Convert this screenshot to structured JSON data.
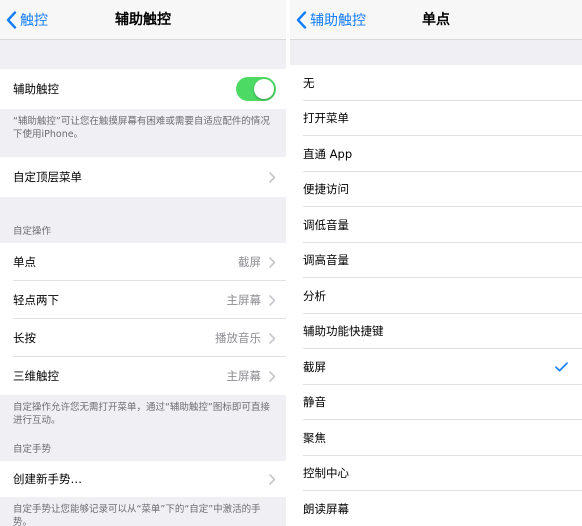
{
  "left": {
    "back_label": "触控",
    "title": "辅助触控",
    "toggle_row": {
      "label": "辅助触控",
      "on": true
    },
    "toggle_footer": "“辅助触控”可让您在触摸屏幕有困难或需要自适应配件的情况下使用iPhone。",
    "top_menu_label": "自定顶层菜单",
    "custom_actions_header": "自定操作",
    "actions": [
      {
        "label": "单点",
        "value": "截屏"
      },
      {
        "label": "轻点两下",
        "value": "主屏幕"
      },
      {
        "label": "长按",
        "value": "播放音乐"
      },
      {
        "label": "三维触控",
        "value": "主屏幕"
      }
    ],
    "actions_footer": "自定操作允许您无需打开菜单，通过“辅助触控”图标即可直接进行互动。",
    "gestures_header": "自定手势",
    "new_gesture_label": "创建新手势…",
    "gestures_footer": "自定手势让您能够记录可以从“菜单”下的“自定”中激活的手势。"
  },
  "right": {
    "back_label": "辅助触控",
    "title": "单点",
    "options": [
      {
        "label": "无"
      },
      {
        "label": "打开菜单"
      },
      {
        "label": "直通 App"
      },
      {
        "label": "便捷访问"
      },
      {
        "label": "调低音量"
      },
      {
        "label": "调高音量"
      },
      {
        "label": "分析"
      },
      {
        "label": "辅助功能快捷键"
      },
      {
        "label": "截屏",
        "selected": true
      },
      {
        "label": "静音"
      },
      {
        "label": "聚焦"
      },
      {
        "label": "控制中心"
      },
      {
        "label": "朗读屏幕"
      }
    ]
  },
  "colors": {
    "accent": "#147efb",
    "toggle_on": "#4cd964",
    "grouped_bg": "#efeff4"
  },
  "icons": {
    "back": "chevron-left-icon",
    "disclosure": "chevron-right-icon",
    "selected": "checkmark-icon"
  }
}
